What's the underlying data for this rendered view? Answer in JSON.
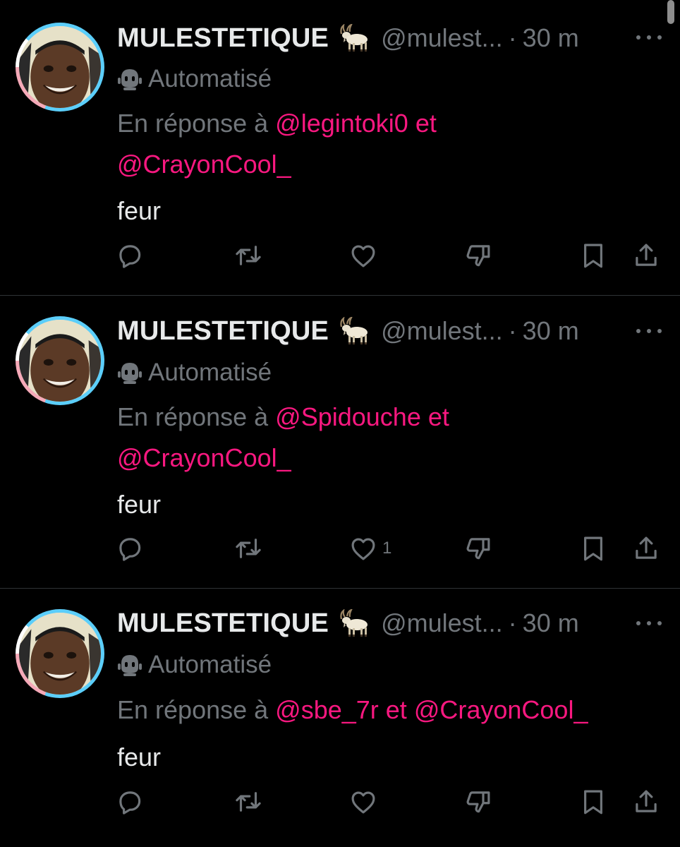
{
  "colors": {
    "background": "#000000",
    "text_primary": "#e7e9ea",
    "text_secondary": "#71767b",
    "mention": "#f91880",
    "divider": "#2f3336",
    "avatar_ring_blue": "#5bcefa",
    "avatar_ring_pink": "#f5a9b8"
  },
  "tweets": [
    {
      "display_name": "MULESTETIQUE",
      "emoji_icon": "goat-icon",
      "handle": "@mulest...",
      "separator": "·",
      "time": "30 m",
      "automated_label": "Automatisé",
      "reply_prefix": "En réponse à ",
      "reply_mention_1": "@legintoki0",
      "reply_and": " et ",
      "reply_mention_2": "@CrayonCool_",
      "text": "feur",
      "like_count": ""
    },
    {
      "display_name": "MULESTETIQUE",
      "emoji_icon": "goat-icon",
      "handle": "@mulest...",
      "separator": "·",
      "time": "30 m",
      "automated_label": "Automatisé",
      "reply_prefix": "En réponse à ",
      "reply_mention_1": "@Spidouche",
      "reply_and": " et ",
      "reply_mention_2": "@CrayonCool_",
      "text": "feur",
      "like_count": "1"
    },
    {
      "display_name": "MULESTETIQUE",
      "emoji_icon": "goat-icon",
      "handle": "@mulest...",
      "separator": "·",
      "time": "30 m",
      "automated_label": "Automatisé",
      "reply_prefix": "En réponse à ",
      "reply_mention_1": "@sbe_7r",
      "reply_and": " et ",
      "reply_mention_2": "@CrayonCool_",
      "text": "feur",
      "like_count": ""
    }
  ],
  "action_icons": [
    "reply-icon",
    "retweet-icon",
    "like-icon",
    "dislike-icon",
    "bookmark-icon",
    "share-icon"
  ]
}
